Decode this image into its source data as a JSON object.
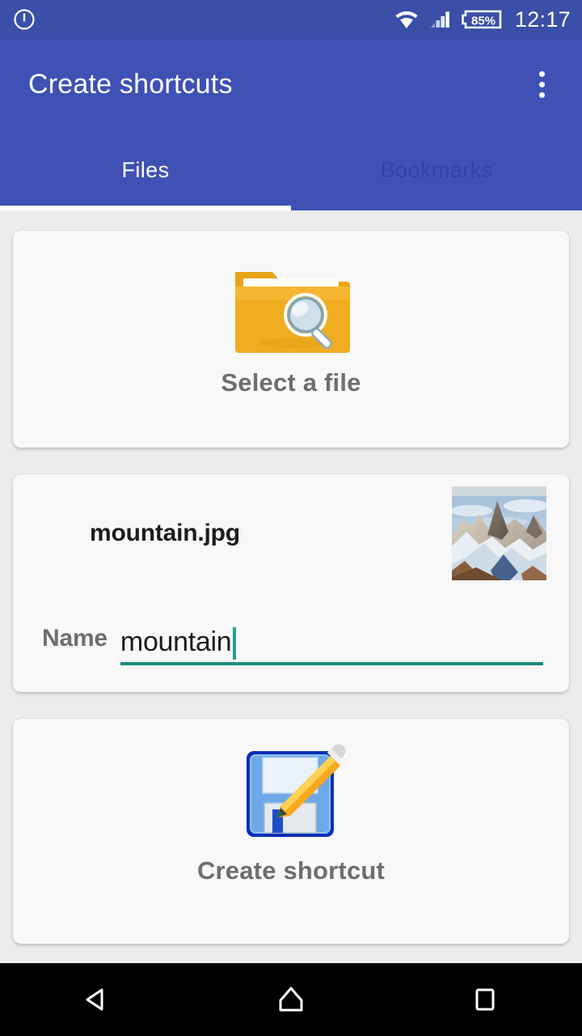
{
  "status_bar": {
    "power_icon": "power-icon",
    "wifi_icon": "wifi-icon",
    "signal_icon": "cell-signal-icon",
    "battery_icon": "battery-icon",
    "battery_level": "85%",
    "time": "12:17"
  },
  "app_bar": {
    "title": "Create shortcuts",
    "overflow_icon": "overflow-menu-icon"
  },
  "tabs": [
    {
      "label": "Files",
      "selected": true
    },
    {
      "label": "Bookmarks",
      "selected": false
    }
  ],
  "cards": {
    "select_file": {
      "icon": "folder-search-icon",
      "caption": "Select a file"
    },
    "file": {
      "file_name": "mountain.jpg",
      "thumbnail": "mountain-photo-thumbnail",
      "name_label": "Name",
      "name_value": "mountain",
      "name_placeholder": "Name"
    },
    "create": {
      "icon": "save-edit-icon",
      "caption": "Create shortcut"
    }
  },
  "nav_bar": {
    "back": "back-icon",
    "home": "home-icon",
    "recents": "recents-icon"
  },
  "colors": {
    "app_bar": "#3f51b5",
    "status_bar": "#3b4fa8",
    "accent_underline": "#1d8a7f",
    "caret": "#1fa294",
    "background": "#ececec",
    "card": "#f8f8f8"
  }
}
